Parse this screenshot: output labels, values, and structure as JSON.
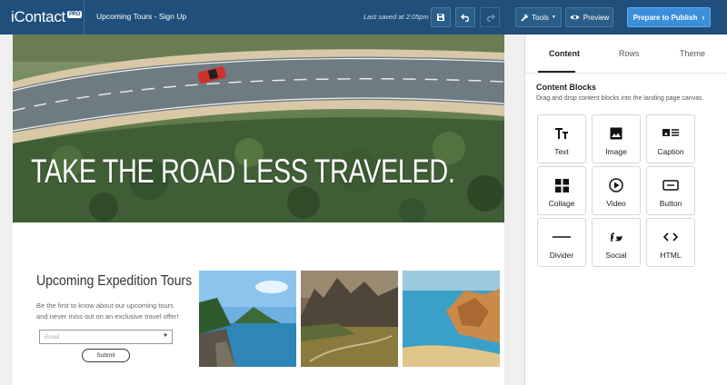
{
  "topbar": {
    "logo": "iContact",
    "logo_badge": "PRO",
    "page_name": "Upcoming Tours - Sign Up",
    "saved_status": "Last saved at 2:05pm",
    "tools_label": "Tools",
    "preview_label": "Preview",
    "publish_label": "Prepare to Publish"
  },
  "hero": {
    "title": "TAKE THE ROAD LESS TRAVELED."
  },
  "section": {
    "title": "Upcoming Expedition Tours",
    "description": "Be the first to know about our upcoming tours and never miss out on an exclusive travel offer!",
    "email_placeholder": "Email",
    "submit_label": "Submit"
  },
  "panel": {
    "tabs": [
      "Content",
      "Rows",
      "Theme"
    ],
    "active_tab": "Content",
    "blocks_title": "Content Blocks",
    "blocks_desc": "Drag and drop content blocks into the landing page canvas.",
    "blocks": [
      {
        "label": "Text",
        "icon": "text-icon"
      },
      {
        "label": "Image",
        "icon": "image-icon"
      },
      {
        "label": "Caption",
        "icon": "caption-icon"
      },
      {
        "label": "Collage",
        "icon": "collage-icon"
      },
      {
        "label": "Video",
        "icon": "video-icon"
      },
      {
        "label": "Button",
        "icon": "button-icon"
      },
      {
        "label": "Divider",
        "icon": "divider-icon"
      },
      {
        "label": "Social",
        "icon": "social-icon"
      },
      {
        "label": "HTML",
        "icon": "html-icon"
      }
    ]
  },
  "colors": {
    "topbar": "#1f4f7a",
    "publish": "#3a8fdb"
  }
}
